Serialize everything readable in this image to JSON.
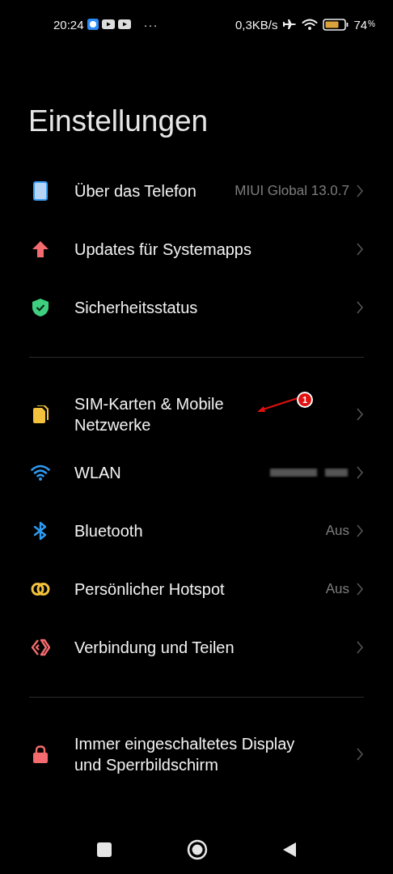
{
  "status_bar": {
    "time": "20:24",
    "overflow": "···",
    "speed": "0,3KB/s",
    "battery": "74",
    "battery_unit": "%"
  },
  "title": "Einstellungen",
  "sections": [
    {
      "items": [
        {
          "label": "Über das Telefon",
          "value": "MIUI Global 13.0.7"
        },
        {
          "label": "Updates für Systemapps"
        },
        {
          "label": "Sicherheitsstatus"
        }
      ]
    },
    {
      "items": [
        {
          "label": "SIM-Karten & Mobile Netzwerke",
          "annotation": "1"
        },
        {
          "label": "WLAN",
          "value_redacted": true
        },
        {
          "label": "Bluetooth",
          "value": "Aus"
        },
        {
          "label": "Persönlicher Hotspot",
          "value": "Aus"
        },
        {
          "label": "Verbindung und Teilen"
        }
      ]
    },
    {
      "items": [
        {
          "label": "Immer eingeschaltetes Display und Sperrbildschirm"
        }
      ]
    }
  ]
}
